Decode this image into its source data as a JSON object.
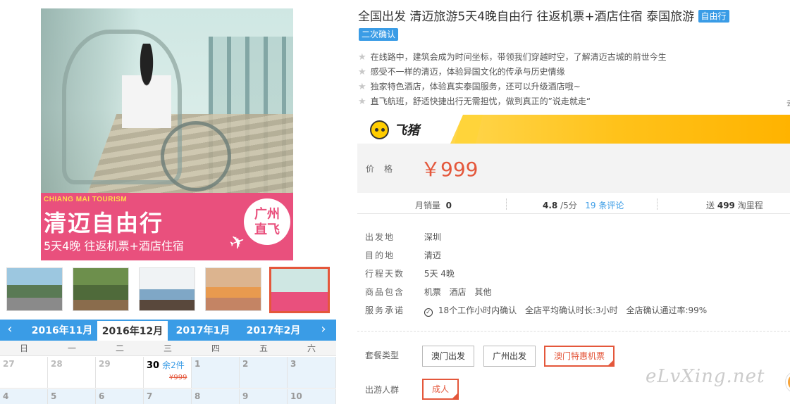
{
  "title": "全国出发 清迈旅游5天4晚自由行 往返机票+酒店住宿 泰国旅游",
  "tag_free": "自由行",
  "tag_confirm": "二次确认",
  "features": [
    "在线路中，建筑会成为时间坐标，带领我们穿越时空，了解清迈古城的前世今生",
    "感受不一样的清迈，体验异国文化的传承与历史情缘",
    "独家特色酒店，体验真实泰国服务，还可以升级酒店哦~",
    "直飞航班，舒适快捷出行无需担忧，做到真正的”说走就走“"
  ],
  "edge_glyph": "去",
  "main_image": {
    "tag": "CHIANG MAI TOURISM",
    "title": "清迈自由行",
    "sub": "5天4晚 往返机票+酒店住宿",
    "badge_line1": "广州",
    "badge_line2": "直飞"
  },
  "brand": {
    "name": "飞猪"
  },
  "price": {
    "label": "价格",
    "value": "￥999"
  },
  "stats": {
    "monthly_label": "月销量",
    "monthly_value": "0",
    "rating": "4.8",
    "rating_suffix": "/5分",
    "reviews": "19 条评论",
    "points_prefix": "送",
    "points_value": "499",
    "points_suffix": "淘里程"
  },
  "details": [
    {
      "label": "出发地",
      "value": "深圳"
    },
    {
      "label": "目的地",
      "value": "清迈"
    },
    {
      "label": "行程天数",
      "value": "5天 4晚"
    }
  ],
  "includes_label": "商品包含",
  "includes": [
    "机票",
    "酒店",
    "其他"
  ],
  "promise_label": "服务承诺",
  "promises": [
    "18个工作小时内确认",
    "全店平均确认时长:3小时",
    "全店确认通过率:99%"
  ],
  "package_label": "套餐类型",
  "packages": [
    "澳门出发",
    "广州出发",
    "澳门特惠机票"
  ],
  "group_label": "出游人群",
  "groups": [
    "成人"
  ],
  "calendar": {
    "prev": "‹",
    "next": "›",
    "months": [
      "2016年11月",
      "2016年12月",
      "2017年1月",
      "2017年2月"
    ],
    "weekdays": [
      "日",
      "一",
      "二",
      "三",
      "四",
      "五",
      "六"
    ],
    "row1": [
      "27",
      "28",
      "29",
      "30",
      "1",
      "2",
      "3"
    ],
    "row2": [
      "4",
      "5",
      "6",
      "7",
      "8",
      "9",
      "10"
    ],
    "today_left": "余2件",
    "today_price": "¥999"
  },
  "watermark": "eLvXing.net"
}
